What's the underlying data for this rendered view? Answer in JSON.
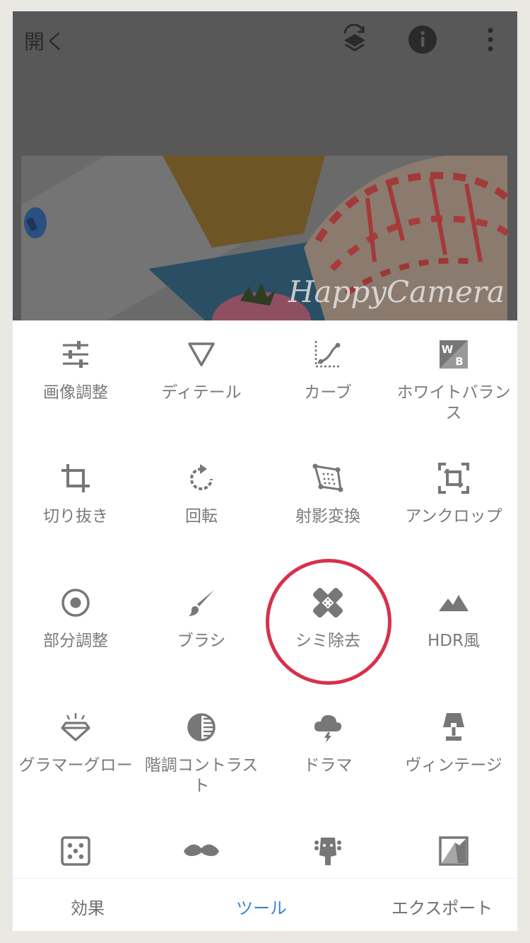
{
  "header": {
    "open_label": "開く",
    "icons": [
      "layers-history-icon",
      "info-icon",
      "more-vert-icon"
    ]
  },
  "photo": {
    "watermark": "HappyCamera"
  },
  "tools": [
    {
      "label": "画像調整",
      "icon": "sliders-icon"
    },
    {
      "label": "ディテール",
      "icon": "triangle-down-icon"
    },
    {
      "label": "カーブ",
      "icon": "curves-icon"
    },
    {
      "label": "ホワイトバランス",
      "icon": "white-balance-icon"
    },
    {
      "label": "切り抜き",
      "icon": "crop-icon"
    },
    {
      "label": "回転",
      "icon": "rotate-icon"
    },
    {
      "label": "射影変換",
      "icon": "perspective-icon"
    },
    {
      "label": "アンクロップ",
      "icon": "expand-icon"
    },
    {
      "label": "部分調整",
      "icon": "selective-target-icon"
    },
    {
      "label": "ブラシ",
      "icon": "brush-icon"
    },
    {
      "label": "シミ除去",
      "icon": "bandage-icon"
    },
    {
      "label": "HDR風",
      "icon": "mountains-icon"
    },
    {
      "label": "グラマーグロー",
      "icon": "diamond-glow-icon"
    },
    {
      "label": "階調コントラスト",
      "icon": "tonal-contrast-icon"
    },
    {
      "label": "ドラマ",
      "icon": "storm-cloud-icon"
    },
    {
      "label": "ヴィンテージ",
      "icon": "lamp-icon"
    },
    {
      "label": "",
      "icon": "grainy-film-icon"
    },
    {
      "label": "",
      "icon": "mustache-icon"
    },
    {
      "label": "",
      "icon": "guitar-head-icon"
    },
    {
      "label": "",
      "icon": "grunge-icon"
    }
  ],
  "highlighted_tool": "シミ除去",
  "colors": {
    "accent": "#3c84c9",
    "highlight": "#d8304b",
    "icon": "#777777"
  },
  "bottom_nav": {
    "tabs": [
      {
        "label": "効果",
        "active": false
      },
      {
        "label": "ツール",
        "active": true
      },
      {
        "label": "エクスポート",
        "active": false
      }
    ]
  }
}
